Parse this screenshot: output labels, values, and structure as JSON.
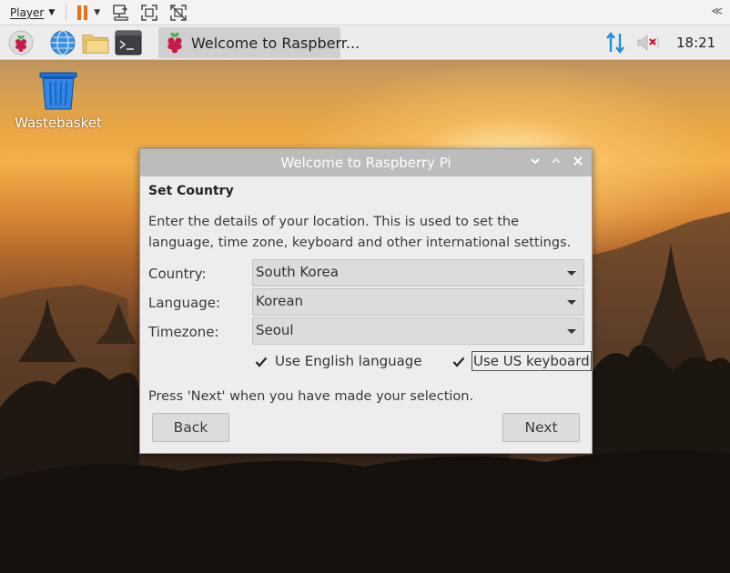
{
  "player_bar": {
    "menu_label": "Player",
    "icons": [
      "pause-icon",
      "send-ctrl-alt-del-icon",
      "fullscreen-icon",
      "unity-icon",
      "collapse-icon"
    ],
    "collapse_glyph": "≪",
    "pause_color": "#e8731a"
  },
  "taskbar": {
    "launchers": [
      "raspberry-menu-icon",
      "web-browser-icon",
      "file-manager-icon",
      "terminal-icon"
    ],
    "task_label": "Welcome to Raspberr...",
    "clock": "18:21",
    "net_color": "#1e8ee0",
    "mute_color": "#d0103a"
  },
  "desktop": {
    "icons": [
      {
        "label": "Wastebasket",
        "icon": "wastebasket-icon"
      }
    ]
  },
  "dialog": {
    "title": "Welcome to Raspberry Pi",
    "section_title": "Set Country",
    "description": "Enter the details of your location. This is used to set the language, time zone, keyboard and other international settings.",
    "fields": {
      "country": {
        "label": "Country:",
        "value": "South Korea"
      },
      "language": {
        "label": "Language:",
        "value": "Korean"
      },
      "timezone": {
        "label": "Timezone:",
        "value": "Seoul"
      }
    },
    "checkboxes": {
      "english": {
        "label": "Use English language",
        "checked": true
      },
      "us_keyboard": {
        "label": "Use US keyboard",
        "checked": true,
        "focused": true
      }
    },
    "hint": "Press 'Next' when you have made your selection.",
    "back_label": "Back",
    "next_label": "Next"
  }
}
